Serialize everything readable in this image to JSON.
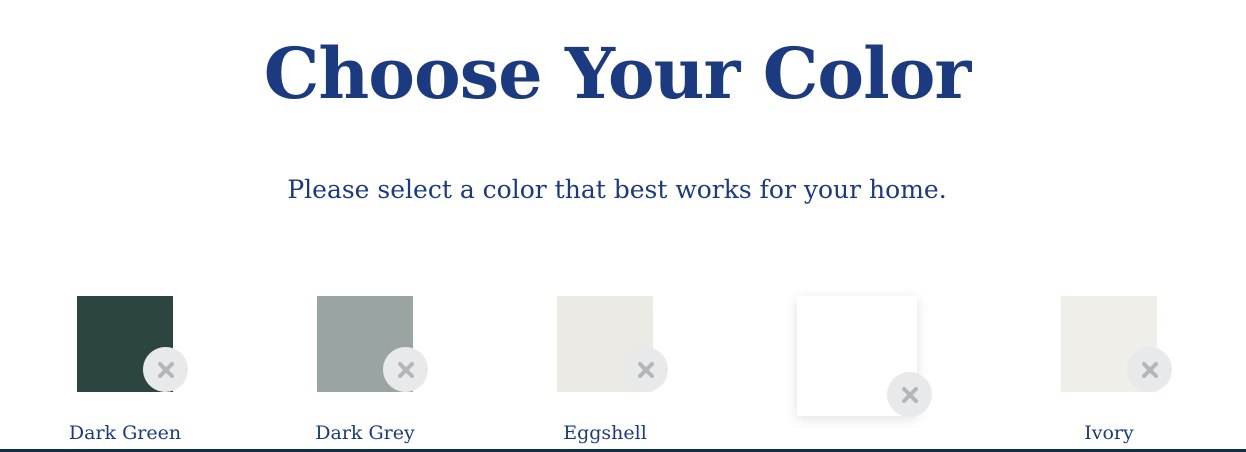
{
  "header": {
    "title": "Choose Your Color",
    "subtitle": "Please select a color that best works for your home."
  },
  "swatches": [
    {
      "label": "Dark Green",
      "color": "#2c4540",
      "selected": false
    },
    {
      "label": "Dark Grey",
      "color": "#9aa5a3",
      "selected": false
    },
    {
      "label": "Eggshell",
      "color": "#ebeae4",
      "selected": false
    },
    {
      "label": "",
      "color": "#ffffff",
      "selected": true
    },
    {
      "label": "Ivory",
      "color": "#efeee8",
      "selected": false
    }
  ],
  "colors": {
    "accent": "#1b3a7f",
    "remove_button_bg": "#e8e9ea",
    "remove_icon": "#b3b6b8",
    "bottom_bar": "#0f2e4a"
  },
  "icons": {
    "remove": "close-icon"
  }
}
